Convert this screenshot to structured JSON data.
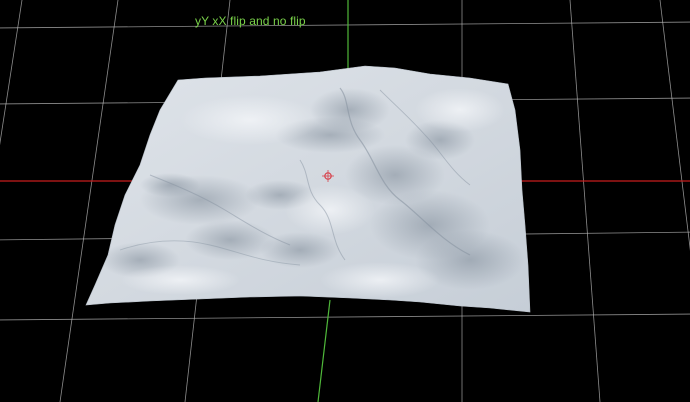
{
  "viewport": {
    "label": "yY xX flip and no flip",
    "colors": {
      "background": "#000000",
      "grid": "#bdbdbd",
      "x_axis": "#c81e1e",
      "y_axis": "#4fb83a",
      "label": "#7ad24a",
      "terrain_base": "#d6dbe1",
      "terrain_shadow": "#8f9aa6",
      "pivot": "#d8404a"
    }
  }
}
